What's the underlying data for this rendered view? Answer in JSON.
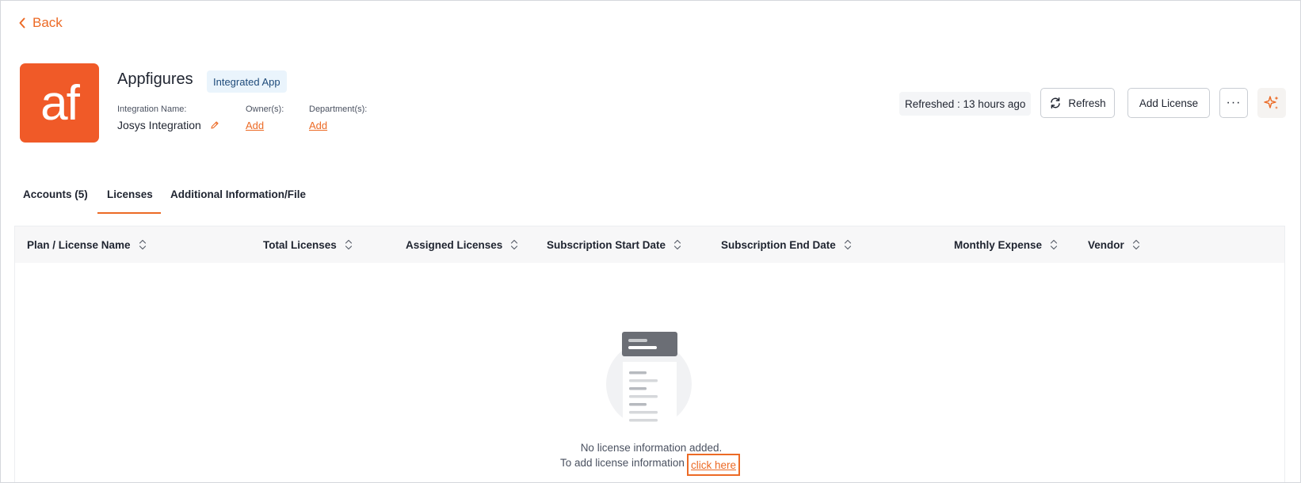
{
  "nav": {
    "back_label": "Back"
  },
  "app": {
    "logo_text": "af",
    "name": "Appfigures",
    "badge": "Integrated App",
    "integration_name_label": "Integration Name:",
    "integration_name": "Josys Integration",
    "owners_label": "Owner(s):",
    "owners_add": "Add",
    "departments_label": "Department(s):",
    "departments_add": "Add"
  },
  "actions": {
    "refreshed_text": "Refreshed : 13 hours ago",
    "refresh_label": "Refresh",
    "add_license_label": "Add License",
    "more_label": "···"
  },
  "tabs": [
    {
      "label": "Accounts (5)",
      "active": false
    },
    {
      "label": "Licenses",
      "active": true
    },
    {
      "label": "Additional Information/File",
      "active": false
    }
  ],
  "table": {
    "columns": [
      "Plan / License Name",
      "Total Licenses",
      "Assigned Licenses",
      "Subscription Start Date",
      "Subscription End Date",
      "Monthly Expense",
      "Vendor"
    ],
    "rows": []
  },
  "empty_state": {
    "title": "No license information added.",
    "prompt": "To add license information",
    "link_label": "click here"
  },
  "colors": {
    "accent": "#ec6a25",
    "logo_bg": "#f05a28",
    "badge_bg": "#eaf4fc",
    "badge_text": "#1f4b7a"
  }
}
